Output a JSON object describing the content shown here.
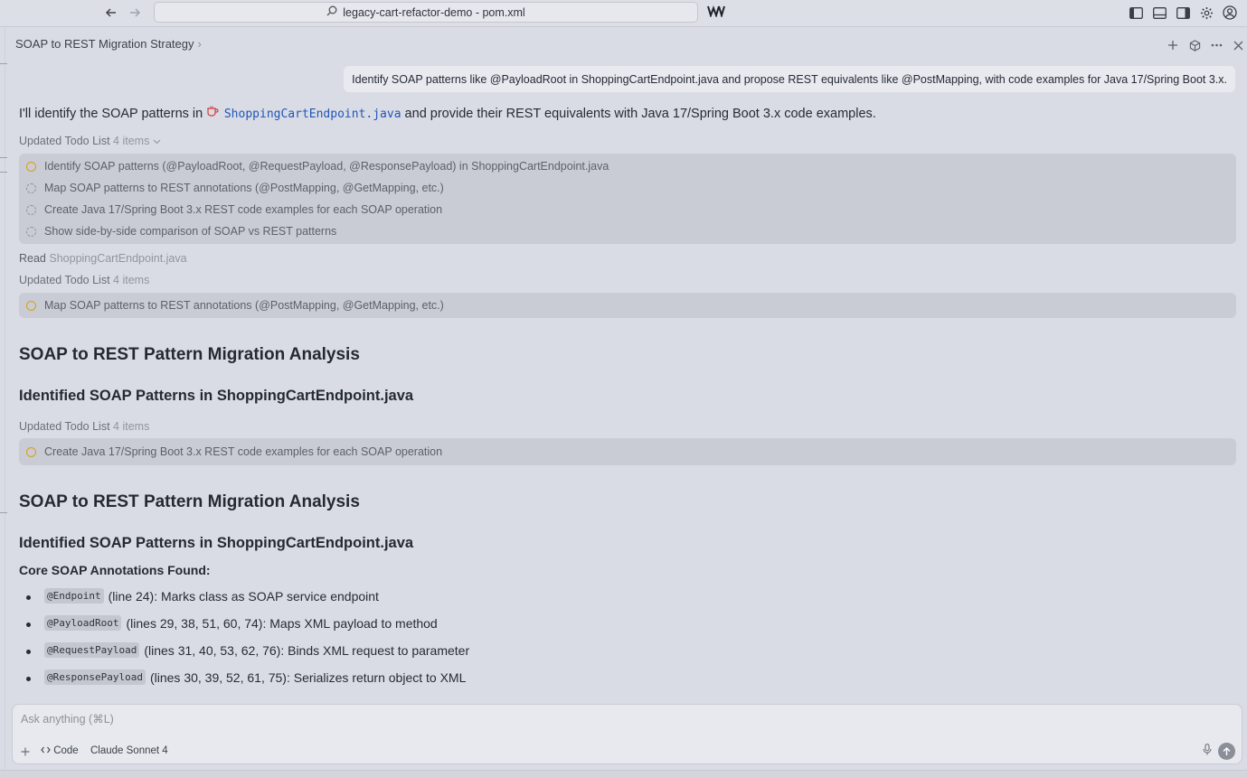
{
  "topbar": {
    "search_text": "legacy-cart-refactor-demo - pom.xml",
    "back_icon": "arrow-left-icon",
    "forward_icon": "arrow-right-icon"
  },
  "panel": {
    "title": "SOAP to REST Migration Strategy",
    "chevron": "›"
  },
  "user_message": "Identify SOAP patterns like @PayloadRoot in ShoppingCartEndpoint.java and propose REST equivalents like @PostMapping, with code examples for Java 17/Spring Boot 3.x.",
  "intro": {
    "before": "I'll identify the SOAP patterns in ",
    "file": "ShoppingCartEndpoint.java",
    "after": " and provide their REST equivalents with Java 17/Spring Boot 3.x code examples."
  },
  "todo1": {
    "label": "Updated Todo List",
    "count": "4 items",
    "items": [
      "Identify SOAP patterns (@PayloadRoot, @RequestPayload, @ResponsePayload) in ShoppingCartEndpoint.java",
      "Map SOAP patterns to REST annotations (@PostMapping, @GetMapping, etc.)",
      "Create Java 17/Spring Boot 3.x REST code examples for each SOAP operation",
      "Show side-by-side comparison of SOAP vs REST patterns"
    ]
  },
  "read": {
    "label": "Read",
    "file": "ShoppingCartEndpoint.java"
  },
  "todo2": {
    "label": "Updated Todo List",
    "count": "4 items",
    "item": "Map SOAP patterns to REST annotations (@PostMapping, @GetMapping, etc.)"
  },
  "section1": {
    "h2": "SOAP to REST Pattern Migration Analysis",
    "h3": "Identified SOAP Patterns in ShoppingCartEndpoint.java"
  },
  "todo3": {
    "label": "Updated Todo List",
    "count": "4 items",
    "item": "Create Java 17/Spring Boot 3.x REST code examples for each SOAP operation"
  },
  "section2": {
    "h2": "SOAP to REST Pattern Migration Analysis",
    "h3": "Identified SOAP Patterns in ShoppingCartEndpoint.java",
    "core_heading": "Core SOAP Annotations Found:",
    "bullets": [
      {
        "code": "@Endpoint",
        "text": "(line 24): Marks class as SOAP service endpoint"
      },
      {
        "code": "@PayloadRoot",
        "text": "(lines 29, 38, 51, 60, 74): Maps XML payload to method"
      },
      {
        "code": "@RequestPayload",
        "text": "(lines 31, 40, 53, 62, 76): Binds XML request to parameter"
      },
      {
        "code": "@ResponsePayload",
        "text": "(lines 30, 39, 52, 61, 75): Serializes return object to XML"
      }
    ]
  },
  "composer": {
    "placeholder": "Ask anything (⌘L)",
    "code_label": "Code",
    "model_label": "Claude Sonnet 4"
  }
}
